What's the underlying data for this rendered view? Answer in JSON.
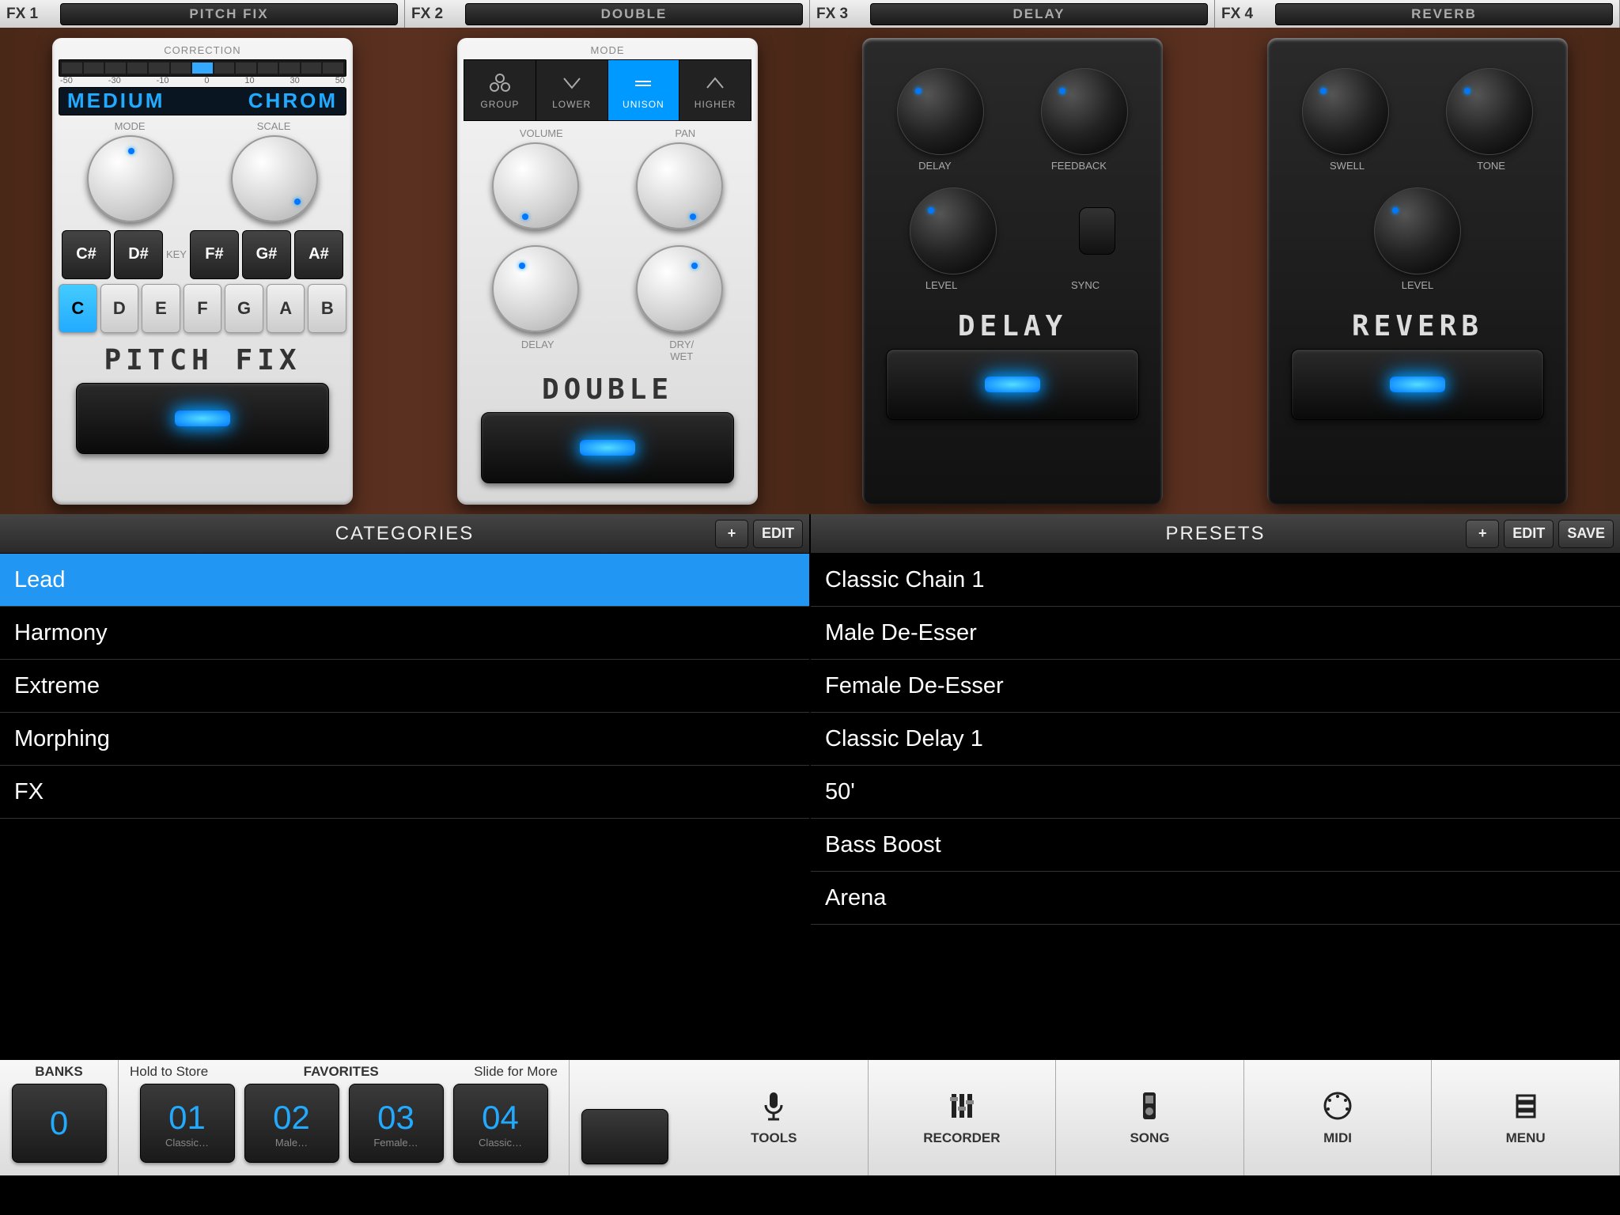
{
  "fx_slots": [
    {
      "label": "FX 1",
      "name": "PITCH FIX"
    },
    {
      "label": "FX 2",
      "name": "DOUBLE"
    },
    {
      "label": "FX 3",
      "name": "DELAY"
    },
    {
      "label": "FX 4",
      "name": "REVERB"
    }
  ],
  "pitchfix": {
    "correction_label": "CORRECTION",
    "ticks": [
      "-50",
      "-30",
      "-10",
      "0",
      "10",
      "30",
      "50"
    ],
    "display_left": "MEDIUM",
    "display_right": "CHROM",
    "mode_label": "MODE",
    "scale_label": "SCALE",
    "key_label": "KEY",
    "sharp_keys": [
      "C#",
      "D#",
      "F#",
      "G#",
      "A#"
    ],
    "nat_keys": [
      "C",
      "D",
      "E",
      "F",
      "G",
      "A",
      "B"
    ],
    "active_key": "C",
    "pedal_name": "PITCH FIX"
  },
  "double": {
    "mode_label": "MODE",
    "modes": [
      "GROUP",
      "LOWER",
      "UNISON",
      "HIGHER"
    ],
    "active_mode": "UNISON",
    "vol_label": "VOLUME",
    "pan_label": "PAN",
    "delay_label": "DELAY",
    "drywet_label": "DRY/\nWET",
    "pedal_name": "DOUBLE"
  },
  "delay": {
    "k1": "DELAY",
    "k2": "FEEDBACK",
    "k3": "LEVEL",
    "sync": "SYNC",
    "pedal_name": "DELAY"
  },
  "reverb": {
    "k1": "SWELL",
    "k2": "TONE",
    "k3": "LEVEL",
    "pedal_name": "REVERB"
  },
  "categories": {
    "title": "CATEGORIES",
    "add": "+",
    "edit": "EDIT",
    "items": [
      "Lead",
      "Harmony",
      "Extreme",
      "Morphing",
      "FX"
    ],
    "selected": "Lead"
  },
  "presets": {
    "title": "PRESETS",
    "add": "+",
    "edit": "EDIT",
    "save": "SAVE",
    "items": [
      "Classic Chain 1",
      "Male De-Esser",
      "Female De-Esser",
      "Classic Delay 1",
      "50'",
      "Bass Boost",
      "Arena"
    ]
  },
  "bottom": {
    "banks_label": "BANKS",
    "banks_num": "0",
    "hold_label": "Hold to Store",
    "favs_label": "FAVORITES",
    "slide_label": "Slide for More",
    "favs": [
      {
        "n": "01",
        "s": "Classic…"
      },
      {
        "n": "02",
        "s": "Male…"
      },
      {
        "n": "03",
        "s": "Female…"
      },
      {
        "n": "04",
        "s": "Classic…"
      }
    ],
    "tools": [
      {
        "name": "TOOLS",
        "icon": "mic"
      },
      {
        "name": "RECORDER",
        "icon": "sliders"
      },
      {
        "name": "SONG",
        "icon": "ipod"
      },
      {
        "name": "MIDI",
        "icon": "midi"
      },
      {
        "name": "MENU",
        "icon": "menu"
      }
    ]
  }
}
